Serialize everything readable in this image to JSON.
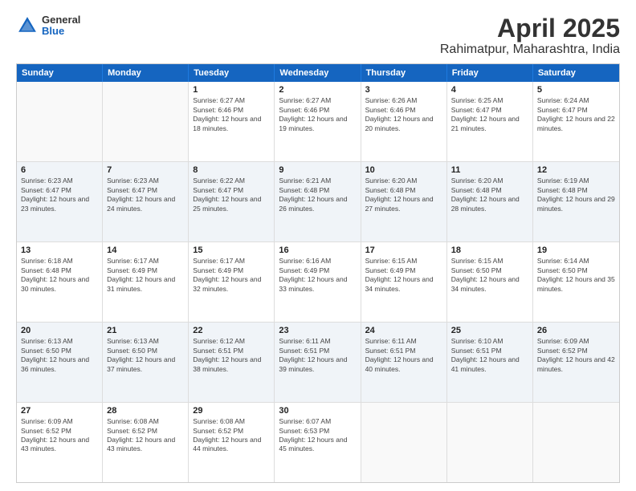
{
  "logo": {
    "general": "General",
    "blue": "Blue"
  },
  "title": "April 2025",
  "subtitle": "Rahimatpur, Maharashtra, India",
  "weekdays": [
    "Sunday",
    "Monday",
    "Tuesday",
    "Wednesday",
    "Thursday",
    "Friday",
    "Saturday"
  ],
  "rows": [
    [
      {
        "day": "",
        "info": ""
      },
      {
        "day": "",
        "info": ""
      },
      {
        "day": "1",
        "info": "Sunrise: 6:27 AM\nSunset: 6:46 PM\nDaylight: 12 hours and 18 minutes."
      },
      {
        "day": "2",
        "info": "Sunrise: 6:27 AM\nSunset: 6:46 PM\nDaylight: 12 hours and 19 minutes."
      },
      {
        "day": "3",
        "info": "Sunrise: 6:26 AM\nSunset: 6:46 PM\nDaylight: 12 hours and 20 minutes."
      },
      {
        "day": "4",
        "info": "Sunrise: 6:25 AM\nSunset: 6:47 PM\nDaylight: 12 hours and 21 minutes."
      },
      {
        "day": "5",
        "info": "Sunrise: 6:24 AM\nSunset: 6:47 PM\nDaylight: 12 hours and 22 minutes."
      }
    ],
    [
      {
        "day": "6",
        "info": "Sunrise: 6:23 AM\nSunset: 6:47 PM\nDaylight: 12 hours and 23 minutes."
      },
      {
        "day": "7",
        "info": "Sunrise: 6:23 AM\nSunset: 6:47 PM\nDaylight: 12 hours and 24 minutes."
      },
      {
        "day": "8",
        "info": "Sunrise: 6:22 AM\nSunset: 6:47 PM\nDaylight: 12 hours and 25 minutes."
      },
      {
        "day": "9",
        "info": "Sunrise: 6:21 AM\nSunset: 6:48 PM\nDaylight: 12 hours and 26 minutes."
      },
      {
        "day": "10",
        "info": "Sunrise: 6:20 AM\nSunset: 6:48 PM\nDaylight: 12 hours and 27 minutes."
      },
      {
        "day": "11",
        "info": "Sunrise: 6:20 AM\nSunset: 6:48 PM\nDaylight: 12 hours and 28 minutes."
      },
      {
        "day": "12",
        "info": "Sunrise: 6:19 AM\nSunset: 6:48 PM\nDaylight: 12 hours and 29 minutes."
      }
    ],
    [
      {
        "day": "13",
        "info": "Sunrise: 6:18 AM\nSunset: 6:48 PM\nDaylight: 12 hours and 30 minutes."
      },
      {
        "day": "14",
        "info": "Sunrise: 6:17 AM\nSunset: 6:49 PM\nDaylight: 12 hours and 31 minutes."
      },
      {
        "day": "15",
        "info": "Sunrise: 6:17 AM\nSunset: 6:49 PM\nDaylight: 12 hours and 32 minutes."
      },
      {
        "day": "16",
        "info": "Sunrise: 6:16 AM\nSunset: 6:49 PM\nDaylight: 12 hours and 33 minutes."
      },
      {
        "day": "17",
        "info": "Sunrise: 6:15 AM\nSunset: 6:49 PM\nDaylight: 12 hours and 34 minutes."
      },
      {
        "day": "18",
        "info": "Sunrise: 6:15 AM\nSunset: 6:50 PM\nDaylight: 12 hours and 34 minutes."
      },
      {
        "day": "19",
        "info": "Sunrise: 6:14 AM\nSunset: 6:50 PM\nDaylight: 12 hours and 35 minutes."
      }
    ],
    [
      {
        "day": "20",
        "info": "Sunrise: 6:13 AM\nSunset: 6:50 PM\nDaylight: 12 hours and 36 minutes."
      },
      {
        "day": "21",
        "info": "Sunrise: 6:13 AM\nSunset: 6:50 PM\nDaylight: 12 hours and 37 minutes."
      },
      {
        "day": "22",
        "info": "Sunrise: 6:12 AM\nSunset: 6:51 PM\nDaylight: 12 hours and 38 minutes."
      },
      {
        "day": "23",
        "info": "Sunrise: 6:11 AM\nSunset: 6:51 PM\nDaylight: 12 hours and 39 minutes."
      },
      {
        "day": "24",
        "info": "Sunrise: 6:11 AM\nSunset: 6:51 PM\nDaylight: 12 hours and 40 minutes."
      },
      {
        "day": "25",
        "info": "Sunrise: 6:10 AM\nSunset: 6:51 PM\nDaylight: 12 hours and 41 minutes."
      },
      {
        "day": "26",
        "info": "Sunrise: 6:09 AM\nSunset: 6:52 PM\nDaylight: 12 hours and 42 minutes."
      }
    ],
    [
      {
        "day": "27",
        "info": "Sunrise: 6:09 AM\nSunset: 6:52 PM\nDaylight: 12 hours and 43 minutes."
      },
      {
        "day": "28",
        "info": "Sunrise: 6:08 AM\nSunset: 6:52 PM\nDaylight: 12 hours and 43 minutes."
      },
      {
        "day": "29",
        "info": "Sunrise: 6:08 AM\nSunset: 6:52 PM\nDaylight: 12 hours and 44 minutes."
      },
      {
        "day": "30",
        "info": "Sunrise: 6:07 AM\nSunset: 6:53 PM\nDaylight: 12 hours and 45 minutes."
      },
      {
        "day": "",
        "info": ""
      },
      {
        "day": "",
        "info": ""
      },
      {
        "day": "",
        "info": ""
      }
    ]
  ]
}
